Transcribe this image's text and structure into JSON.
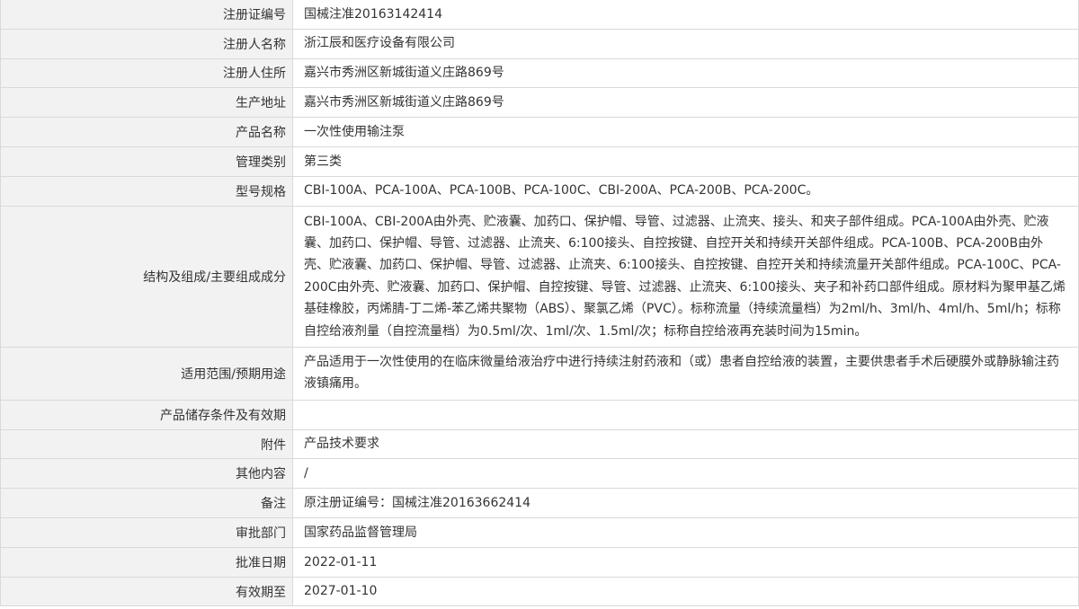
{
  "record": {
    "rows": [
      {
        "label": "注册证编号",
        "value": "国械注准20163142414"
      },
      {
        "label": "注册人名称",
        "value": "浙江辰和医疗设备有限公司"
      },
      {
        "label": "注册人住所",
        "value": "嘉兴市秀洲区新城街道义庄路869号"
      },
      {
        "label": "生产地址",
        "value": "嘉兴市秀洲区新城街道义庄路869号"
      },
      {
        "label": "产品名称",
        "value": "一次性使用输注泵"
      },
      {
        "label": "管理类别",
        "value": "第三类"
      },
      {
        "label": "型号规格",
        "value": "CBI-100A、PCA-100A、PCA-100B、PCA-100C、CBI-200A、PCA-200B、PCA-200C。"
      },
      {
        "label": "结构及组成/主要组成成分",
        "value": "CBI-100A、CBI-200A由外壳、贮液囊、加药口、保护帽、导管、过滤器、止流夹、接头、和夹子部件组成。PCA-100A由外壳、贮液囊、加药口、保护帽、导管、过滤器、止流夹、6:100接头、自控按键、自控开关和持续开关部件组成。PCA-100B、PCA-200B由外壳、贮液囊、加药口、保护帽、导管、过滤器、止流夹、6:100接头、自控按键、自控开关和持续流量开关部件组成。PCA-100C、PCA-200C由外壳、贮液囊、加药口、保护帽、自控按键、导管、过滤器、止流夹、6:100接头、夹子和补药口部件组成。原材料为聚甲基乙烯基硅橡胶，丙烯腈-丁二烯-苯乙烯共聚物（ABS）、聚氯乙烯（PVC）。标称流量（持续流量档）为2ml/h、3ml/h、4ml/h、5ml/h；标称自控给液剂量（自控流量档）为0.5ml/次、1ml/次、1.5ml/次；标称自控给液再充装时间为15min。"
      },
      {
        "label": "适用范围/预期用途",
        "value": "产品适用于一次性使用的在临床微量给液治疗中进行持续注射药液和（或）患者自控给液的装置，主要供患者手术后硬膜外或静脉输注药液镇痛用。"
      },
      {
        "label": "产品储存条件及有效期",
        "value": ""
      },
      {
        "label": "附件",
        "value": "产品技术要求"
      },
      {
        "label": "其他内容",
        "value": "/"
      },
      {
        "label": "备注",
        "value": "原注册证编号：国械注准20163662414"
      },
      {
        "label": "审批部门",
        "value": "国家药品监督管理局"
      },
      {
        "label": "批准日期",
        "value": "2022-01-11"
      },
      {
        "label": "有效期至",
        "value": "2027-01-10"
      }
    ]
  },
  "colors": {
    "label_bg": "#f2f2f2",
    "border": "#d9d9d9",
    "text": "#333333"
  }
}
